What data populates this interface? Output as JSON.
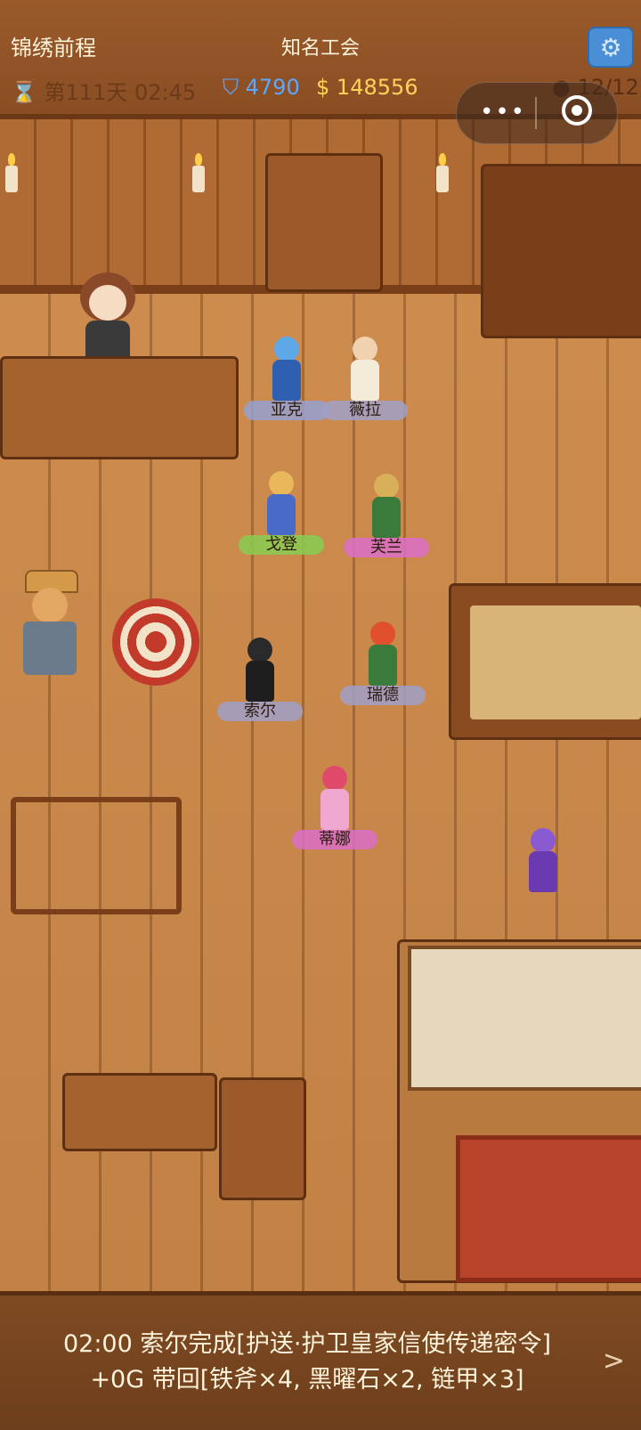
{
  "header": {
    "game_title": "锦绣前程",
    "location": "知名工会",
    "settings_icon": "gear-icon"
  },
  "stats": {
    "day_icon": "hourglass-icon",
    "day_label": "第111天 02:45",
    "shield_icon": "shield-icon",
    "reputation": "4790",
    "gold_icon": "money-bag-icon",
    "gold": "148556",
    "party_icon": "person-icon",
    "party": "12/12"
  },
  "capsule": {
    "more_icon": "more-dots-icon",
    "close_icon": "target-icon"
  },
  "heroes": [
    {
      "name": "亚克"
    },
    {
      "name": "薇拉"
    },
    {
      "name": "戈登"
    },
    {
      "name": "芙兰"
    },
    {
      "name": "索尔"
    },
    {
      "name": "瑞德"
    },
    {
      "name": "蒂娜"
    }
  ],
  "log": {
    "line1": "02:00 索尔完成[护送·护卫皇家信使传递密令]",
    "line2": "+0G 带回[铁斧×4, 黑曜石×2, 链甲×3]",
    "next_icon": ">"
  },
  "colors": {
    "settings_button": "#4a8fd6",
    "reputation": "#5aa8ff",
    "gold": "#ffd35a"
  }
}
